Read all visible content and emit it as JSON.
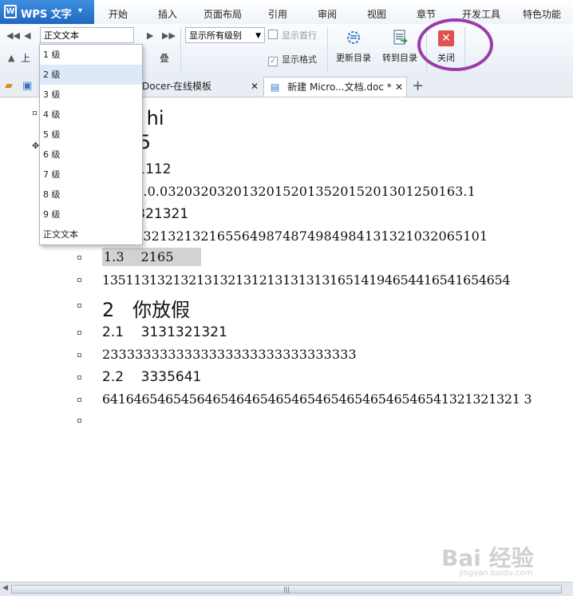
{
  "app": {
    "brand": "WPS 文字"
  },
  "menu_tabs": [
    "开始",
    "插入",
    "页面布局",
    "引用",
    "审阅",
    "视图",
    "章节",
    "开发工具",
    "特色功能"
  ],
  "toolbar": {
    "style_select_value": "正文文本",
    "level_select_value": "显示所有级别",
    "show_first_line_label": "显示首行",
    "show_format_label": "显示格式",
    "update_toc_label": "更新目录",
    "goto_toc_label": "转到目录",
    "close_label": "关闭",
    "promote_partial": "上",
    "collapse_partial": "叠"
  },
  "doc_tabs": [
    {
      "label": "Docer-在线模板",
      "active": false
    },
    {
      "label": "新建 Micro...文档.doc *",
      "active": true
    }
  ],
  "level_dropdown": {
    "items": [
      "1 级",
      "2 级",
      "3 级",
      "4 级",
      "5 级",
      "6 级",
      "7 级",
      "8 级",
      "9 级",
      "正文文本"
    ],
    "selected_index": 1
  },
  "document": {
    "lines": [
      {
        "text": "看费 hi",
        "style": "h1"
      },
      {
        "text": "5465",
        "style": "h1"
      },
      {
        "text": "10011112",
        "style": "h2"
      },
      {
        "text": "03020.0.0320320320132015201352015201301250163.1",
        "style": "mono"
      },
      {
        "text": "1321321321",
        "style": "h2"
      },
      {
        "text": "21321321321321655649874874984984131321032065101",
        "style": "mono"
      },
      {
        "text": "1.3    2165",
        "style": "mono-hl"
      },
      {
        "text": "1351131321321313213121313131316514194654416541654654",
        "style": "mono"
      },
      {
        "text": "2   你放假",
        "style": "h1"
      },
      {
        "text": "2.1    3131321321",
        "style": "h2"
      },
      {
        "text": "2333333333333333333333333333333",
        "style": "mono"
      },
      {
        "text": "2.2    3335641",
        "style": "h2"
      },
      {
        "text": "64164654654564654646546546546546546546546541321321321 3",
        "style": "mono"
      }
    ]
  },
  "watermark": {
    "main": "Bai 经验",
    "sub": "jingyan.baidu.com"
  },
  "colors": {
    "brand_blue": "#2a78d2",
    "annotation_circle": "#9b3da8",
    "close_red": "#e05252"
  }
}
